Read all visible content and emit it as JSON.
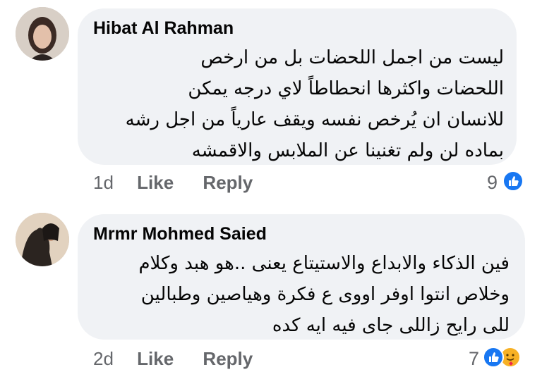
{
  "comments": [
    {
      "author": "Hibat Al Rahman",
      "lines": [
        "ليست من اجمل اللحضات بل من ارخص",
        "اللحضات واكثرها انحطاطاً  لاي درجه يمكن",
        "للانسان ان يُرخص نفسه ويقف عارياً من اجل رشه",
        "بماده لن ولم تغنينا عن الملابس والاقمشه"
      ],
      "time": "1d",
      "like_label": "Like",
      "reply_label": "Reply",
      "reaction_count": "9",
      "reactions": [
        "like-icon"
      ]
    },
    {
      "author": "Mrmr Mohmed Saied",
      "lines": [
        "فين الذكاء والابداع والاستيتاع يعنى ..هو هبد وكلام",
        "وخلاص انتوا اوفر اووى ع فكرة وهياصين وطبالين",
        "للى رايح زاللى جاى فيه ايه كده"
      ],
      "time": "2d",
      "like_label": "Like",
      "reply_label": "Reply",
      "reaction_count": "7",
      "reactions": [
        "like-icon",
        "care-icon"
      ]
    }
  ],
  "colors": {
    "bubble": "#f0f2f5",
    "meta": "#65676b",
    "like_blue": "#1877f2",
    "care_yellow": "#f7b125"
  }
}
